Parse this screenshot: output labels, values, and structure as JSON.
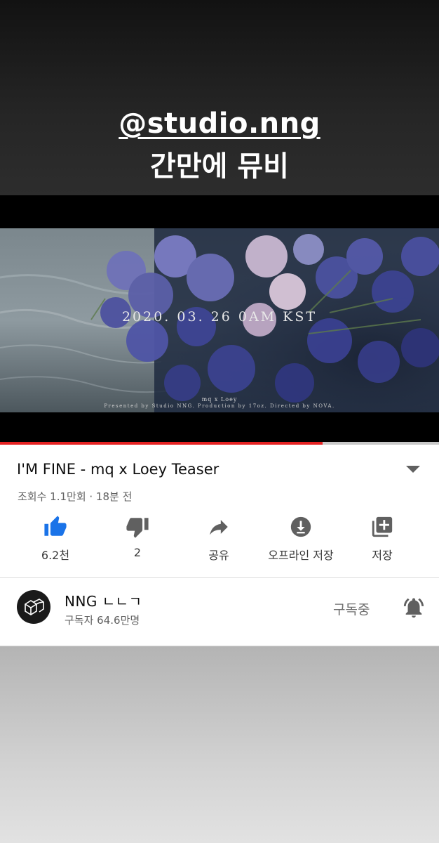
{
  "story": {
    "mention": "@studio.nng",
    "caption": "간만에 뮤비"
  },
  "video_frame": {
    "date_text": "2020. 03. 26 0AM KST",
    "credit_title": "mq x Loey",
    "credit_line": "Presented by Studio NNG. Production by 17oz. Directed by NOVA."
  },
  "progress": {
    "played_fraction": 0.735
  },
  "video": {
    "title": "I'M FINE - mq x Loey Teaser",
    "meta": "조회수 1.1만회 · 18분 전"
  },
  "actions": [
    {
      "icon": "thumbs-up-icon",
      "label": "6.2천",
      "active": true
    },
    {
      "icon": "thumbs-down-icon",
      "label": "2"
    },
    {
      "icon": "share-icon",
      "label": "공유"
    },
    {
      "icon": "download-icon",
      "label": "오프라인 저장"
    },
    {
      "icon": "playlist-add-icon",
      "label": "저장"
    }
  ],
  "channel": {
    "name": "NNG ㄴㄴㄱ",
    "subscribers": "구독자 64.6만명",
    "subscribe_state": "구독중"
  },
  "colors": {
    "like_active": "#1a73e8",
    "progress_played": "#e52222",
    "icon_gray": "#606060"
  }
}
